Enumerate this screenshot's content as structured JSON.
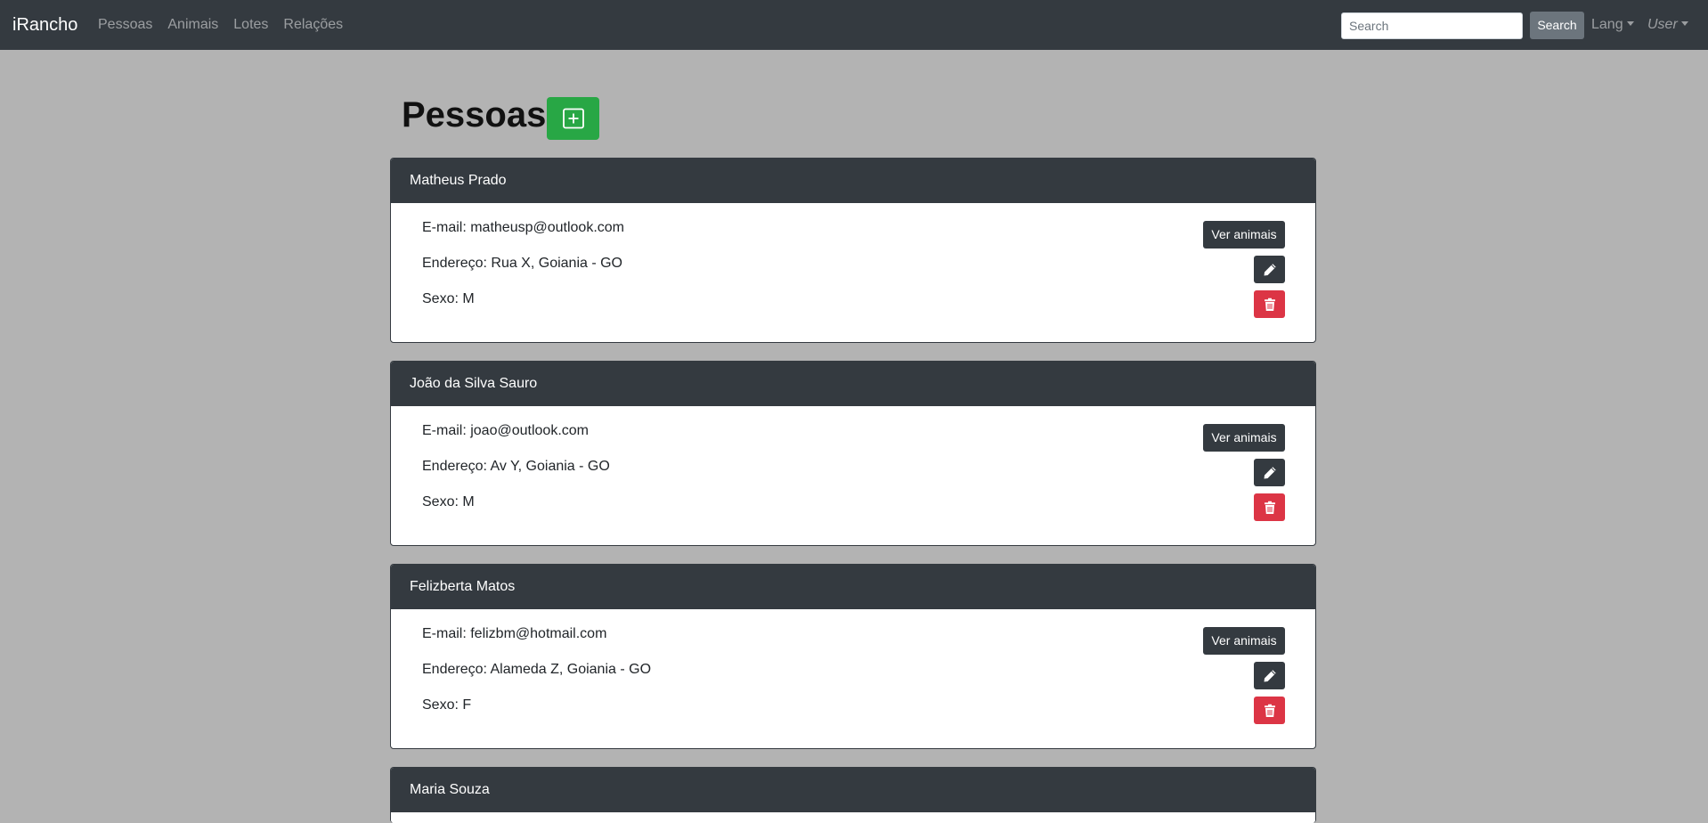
{
  "navbar": {
    "brand": "iRancho",
    "links": [
      "Pessoas",
      "Animais",
      "Lotes",
      "Relações"
    ],
    "search_placeholder": "Search",
    "search_button": "Search",
    "lang": "Lang",
    "user": "User"
  },
  "page": {
    "title": "Pessoas"
  },
  "people": [
    {
      "name": "Matheus Prado",
      "email": "E-mail: matheusp@outlook.com",
      "address": "Endereço: Rua X, Goiania - GO",
      "sex": "Sexo: M"
    },
    {
      "name": "João da Silva Sauro",
      "email": "E-mail: joao@outlook.com",
      "address": "Endereço: Av Y, Goiania - GO",
      "sex": "Sexo: M"
    },
    {
      "name": "Felizberta Matos",
      "email": "E-mail: felizbm@hotmail.com",
      "address": "Endereço: Alameda Z, Goiania - GO",
      "sex": "Sexo: F"
    },
    {
      "name": "Maria Souza"
    }
  ],
  "card_actions": {
    "view_animals": "Ver animais",
    "edit_icon": "pencil-icon",
    "delete_icon": "trash-icon"
  },
  "colors": {
    "navbar": "#343a40",
    "background": "#b3b3b3",
    "add_button": "#28a745",
    "delete_button": "#dc3545"
  }
}
